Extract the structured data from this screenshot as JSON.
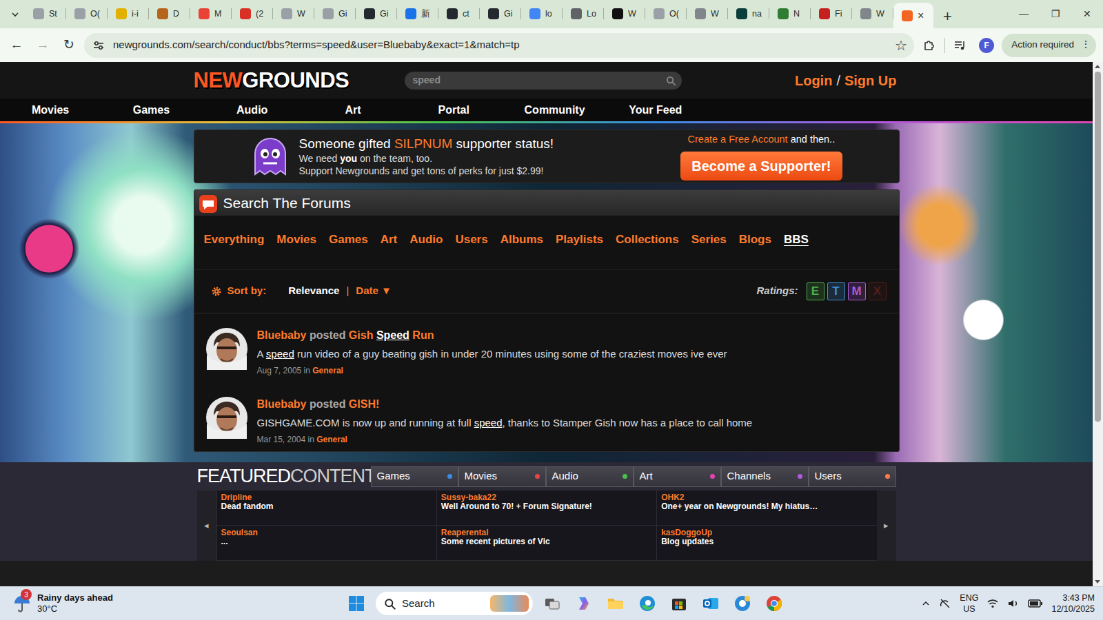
{
  "browser": {
    "tabs": [
      {
        "label": "St",
        "selected": false,
        "color": "#9aa0a6"
      },
      {
        "label": "O(",
        "selected": false,
        "color": "#9aa0a6"
      },
      {
        "label": "i-i",
        "selected": false,
        "color": "#e2b100"
      },
      {
        "label": "D",
        "selected": false,
        "color": "#b5651d"
      },
      {
        "label": "M",
        "selected": false,
        "color": "#ea4335"
      },
      {
        "label": "(2",
        "selected": false,
        "color": "#d93025"
      },
      {
        "label": "W",
        "selected": false,
        "color": "#9aa0a6"
      },
      {
        "label": "Gi",
        "selected": false,
        "color": "#9aa0a6"
      },
      {
        "label": "Gi",
        "selected": false,
        "color": "#24292f"
      },
      {
        "label": "新",
        "selected": false,
        "color": "#1a73e8"
      },
      {
        "label": "ct",
        "selected": false,
        "color": "#24292f"
      },
      {
        "label": "Gi",
        "selected": false,
        "color": "#24292f"
      },
      {
        "label": "lo",
        "selected": false,
        "color": "#4285f4"
      },
      {
        "label": "Lo",
        "selected": false,
        "color": "#5f6368"
      },
      {
        "label": "W",
        "selected": false,
        "color": "#111111"
      },
      {
        "label": "O(",
        "selected": false,
        "color": "#9aa0a6"
      },
      {
        "label": "W",
        "selected": false,
        "color": "#80868b"
      },
      {
        "label": "na",
        "selected": false,
        "color": "#0b3d3a"
      },
      {
        "label": "N",
        "selected": false,
        "color": "#2e7d32"
      },
      {
        "label": "Fi",
        "selected": false,
        "color": "#c5221f"
      },
      {
        "label": "W",
        "selected": false,
        "color": "#80868b"
      },
      {
        "selected": true,
        "color": "#f26522",
        "close": "×"
      }
    ],
    "new_tab": "+",
    "window_controls": [
      "—",
      "❐",
      "✕"
    ],
    "nav_buttons": [
      {
        "glyph": "←",
        "disabled": false
      },
      {
        "glyph": "→",
        "disabled": true
      },
      {
        "glyph": "↻",
        "disabled": false
      }
    ],
    "url": "newgrounds.com/search/conduct/bbs?terms=speed&user=Bluebaby&exact=1&match=tp",
    "bookmark": "☆",
    "profile": "F",
    "action": "Action required",
    "menu": "⋮"
  },
  "site": {
    "logo": [
      "NEW",
      "GROUNDS"
    ],
    "search_value": "speed",
    "login": "Login",
    "slash": "/",
    "signup": "Sign Up",
    "nav": [
      "Movies",
      "Games",
      "Audio",
      "Art",
      "Portal",
      "Community",
      "Your Feed"
    ]
  },
  "banner": {
    "headline": [
      "Someone gifted ",
      "SILPNUM",
      " supporter status!"
    ],
    "line2": [
      "We need ",
      "you",
      " on the team, too."
    ],
    "line3": "Support Newgrounds and get tons of perks for just $2.99!",
    "cta": [
      "Create a Free Account",
      " and then.."
    ],
    "button": "Become a Supporter!"
  },
  "forums": {
    "title": "Search The Forums",
    "filters": [
      {
        "label": "Everything",
        "selected": false
      },
      {
        "label": "Movies",
        "selected": false
      },
      {
        "label": "Games",
        "selected": false
      },
      {
        "label": "Art",
        "selected": false
      },
      {
        "label": "Audio",
        "selected": false
      },
      {
        "label": "Users",
        "selected": false
      },
      {
        "label": "Albums",
        "selected": false
      },
      {
        "label": "Playlists",
        "selected": false
      },
      {
        "label": "Collections",
        "selected": false
      },
      {
        "label": "Series",
        "selected": false
      },
      {
        "label": "Blogs",
        "selected": false
      },
      {
        "label": "BBS",
        "selected": true
      }
    ],
    "sort_label": "Sort by:",
    "sort_sep": "|",
    "sort": [
      {
        "label": "Relevance",
        "selected": true
      },
      {
        "label": "Date",
        "selected": false,
        "arrow": "▼"
      }
    ],
    "ratings_label": "Ratings:",
    "ratings": [
      {
        "label": "E",
        "on": true,
        "color": "#4caf50"
      },
      {
        "label": "T",
        "on": true,
        "color": "#3f8fd8"
      },
      {
        "label": "M",
        "on": true,
        "color": "#b05ad8"
      },
      {
        "label": "X",
        "on": false,
        "color": "#c0392b"
      }
    ]
  },
  "results": [
    {
      "author": "Bluebaby",
      "verb": " posted ",
      "title": [
        {
          "text": "Gish ",
          "match": false
        },
        {
          "text": "Speed",
          "match": true
        },
        {
          "text": " Run",
          "match": false
        }
      ],
      "snippet": [
        {
          "text": "A ",
          "match": false
        },
        {
          "text": "speed",
          "match": true
        },
        {
          "text": " run video of a guy beating gish in under 20 minutes using some of the craziest moves ive ever",
          "match": false
        }
      ],
      "date": "Aug 7, 2005",
      "in": "in",
      "forum": "General"
    },
    {
      "author": "Bluebaby",
      "verb": " posted ",
      "title": [
        {
          "text": "GISH!",
          "match": false
        }
      ],
      "snippet": [
        {
          "text": "GISHGAME.COM is now up and running at full ",
          "match": false
        },
        {
          "text": "speed",
          "match": true
        },
        {
          "text": ", thanks to Stamper Gish now has a place to call home",
          "match": false
        }
      ],
      "date": "Mar 15, 2004",
      "in": "in",
      "forum": "General"
    }
  ],
  "featured": {
    "title": [
      "FEATURED",
      "CONTENT"
    ],
    "tabs": [
      {
        "label": "Games",
        "color": "#3a8ee6"
      },
      {
        "label": "Movies",
        "color": "#e64545"
      },
      {
        "label": "Audio",
        "color": "#4ac24a"
      },
      {
        "label": "Art",
        "color": "#e045b0"
      },
      {
        "label": "Channels",
        "color": "#b05ae0"
      },
      {
        "label": "Users",
        "color": "#ff7a4a"
      }
    ],
    "prev": "◂",
    "next": "▸",
    "items": [
      {
        "user": "Dripline",
        "text": "Dead fandom"
      },
      {
        "user": "Sussy-baka22",
        "text": "Well Around to 70! + Forum Signature!"
      },
      {
        "user": "OHK2",
        "text": "One+ year on Newgrounds! My hiatus…"
      },
      {
        "user": "Seoulsan",
        "text": "..."
      },
      {
        "user": "Reaperental",
        "text": "Some recent pictures of Vic"
      },
      {
        "user": "kasDoggoUp",
        "text": "Blog updates"
      }
    ]
  },
  "taskbar": {
    "weather_badge": "3",
    "weather_title": "Rainy days ahead",
    "weather_temp": "30°C",
    "search": "Search",
    "lang": [
      "ENG",
      "US"
    ],
    "time": "3:43 PM",
    "date": "12/10/2025"
  }
}
